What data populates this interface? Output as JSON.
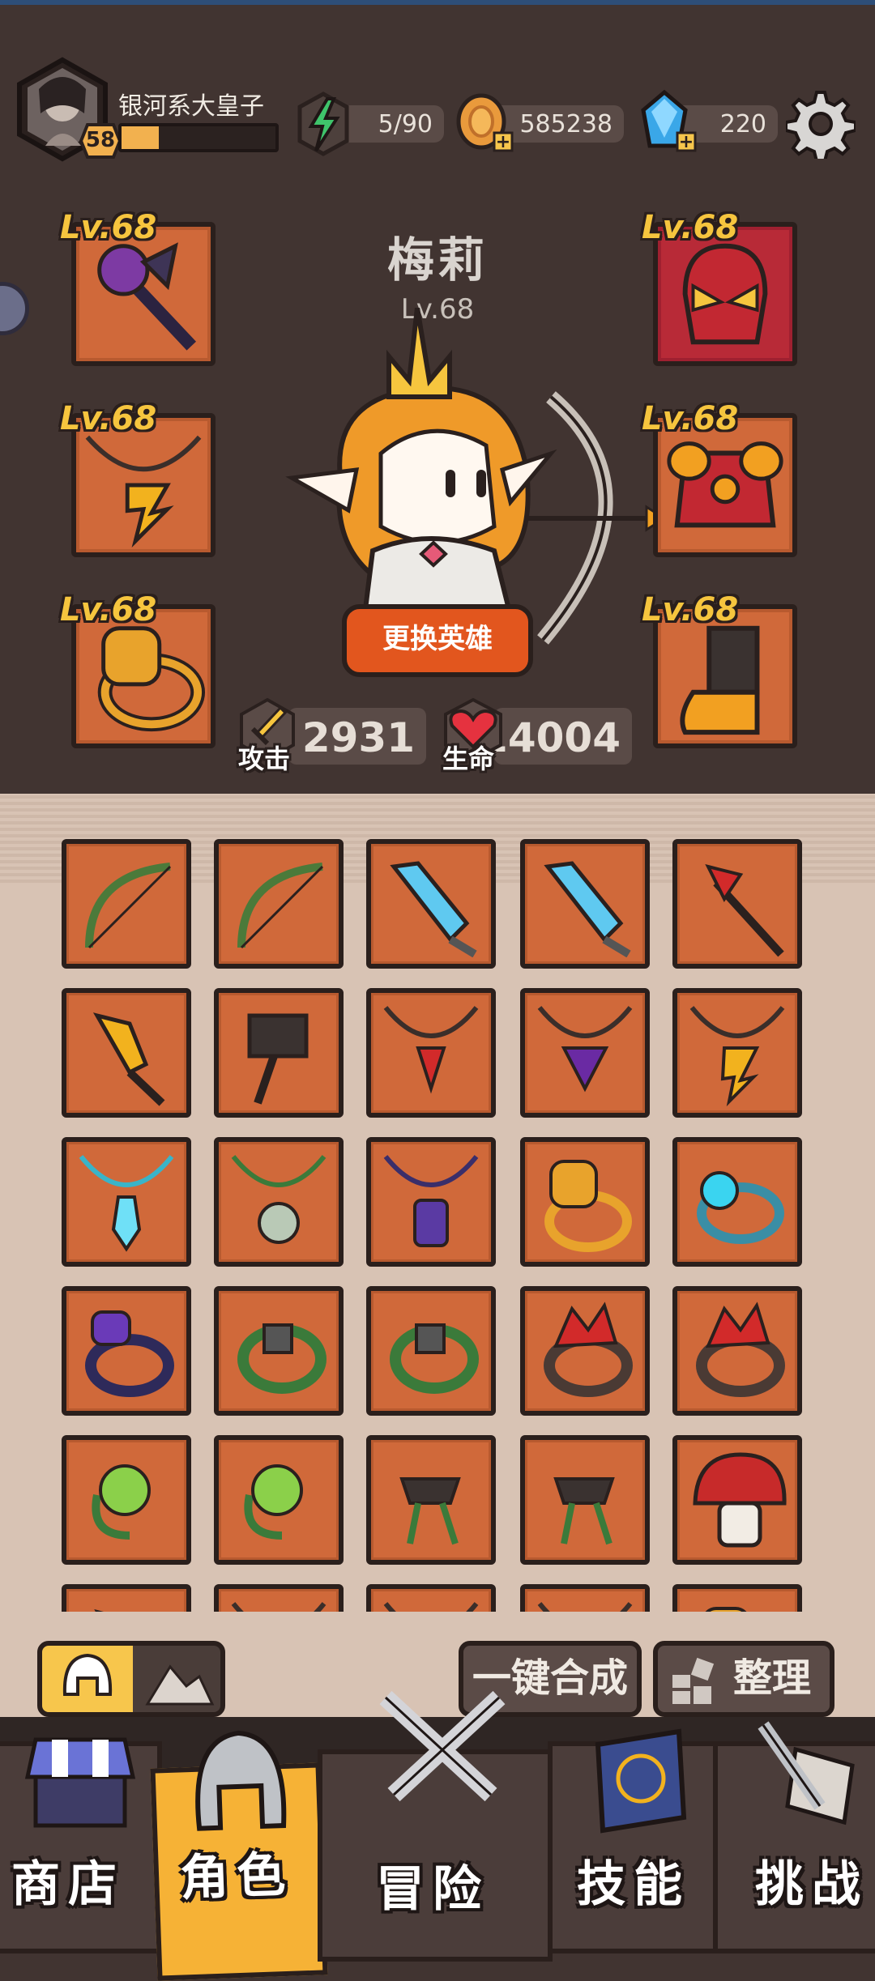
{
  "player": {
    "name": "银河系大皇子",
    "level": "58",
    "xp_progress": 0.24,
    "energy": "5/90",
    "coins": "585238",
    "gems": "220"
  },
  "hero": {
    "name": "梅莉",
    "level": "Lv.68",
    "change_button": "更换英雄",
    "attack_label": "攻击",
    "attack_value": "2931",
    "hp_label": "生命",
    "hp_value": "14004"
  },
  "equipment": {
    "weapon_lv": "Lv.68",
    "necklace_lv": "Lv.68",
    "ring_lv": "Lv.68",
    "helmet_lv": "Lv.68",
    "armor_lv": "Lv.68",
    "boots_lv": "Lv.68"
  },
  "toolbar": {
    "merge_all": "一键合成",
    "sort": "整理"
  },
  "nav": {
    "shop": "商店",
    "character": "角色",
    "adventure": "冒险",
    "skills": "技能",
    "challenge": "挑战"
  },
  "icons": {
    "gear": "settings-gear-icon",
    "energy": "lightning-icon",
    "coin": "coin-icon",
    "gem": "gem-icon"
  },
  "colors": {
    "background": "#413431",
    "slot_orange": "#d0693a",
    "accent_orange": "#e2561e",
    "gold": "#f7c64c"
  }
}
